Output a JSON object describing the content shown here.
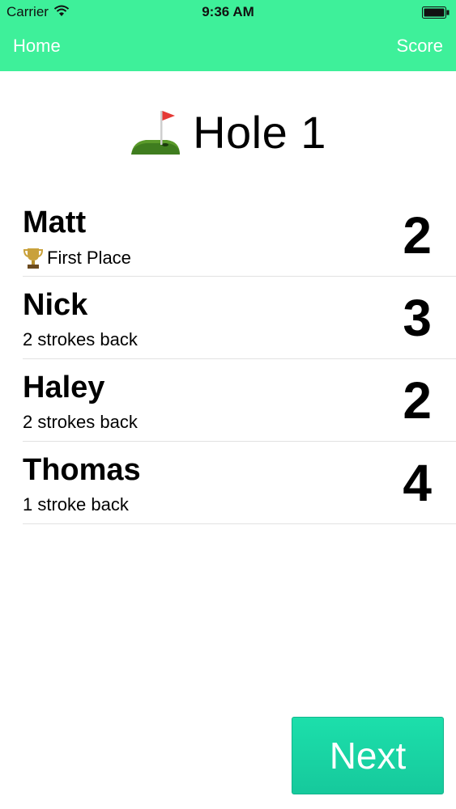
{
  "status_bar": {
    "carrier": "Carrier",
    "time": "9:36 AM"
  },
  "nav": {
    "home_label": "Home",
    "score_label": "Score"
  },
  "title": "Hole 1",
  "players": [
    {
      "name": "Matt",
      "status": "First Place",
      "score": "2"
    },
    {
      "name": "Nick",
      "status": "2 strokes back",
      "score": "3"
    },
    {
      "name": "Haley",
      "status": "2 strokes back",
      "score": "2"
    },
    {
      "name": "Thomas",
      "status": "1 stroke back",
      "score": "4"
    }
  ],
  "next_label": "Next",
  "colors": {
    "header": "#3ef09a",
    "next_button": "#1cdfab"
  },
  "icons": [
    "wifi-icon",
    "battery-icon",
    "golf-flag-icon",
    "trophy-icon"
  ]
}
